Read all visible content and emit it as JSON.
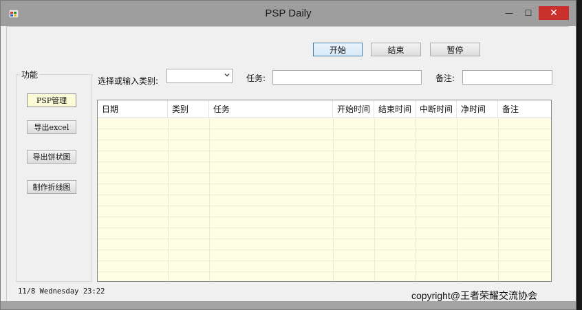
{
  "window": {
    "title": "PSP Daily"
  },
  "titlebar": {
    "minimize_glyph": "—",
    "maximize_glyph": "☐",
    "close_glyph": "✕"
  },
  "timer_buttons": {
    "start": "开始",
    "stop": "结束",
    "pause": "暂停"
  },
  "function_panel": {
    "title": "功能",
    "buttons": [
      "PSP管理",
      "导出excel",
      "导出饼状图",
      "制作折线图"
    ]
  },
  "form": {
    "category_label": "选择或输入类别:",
    "category_value": "",
    "task_label": "任务:",
    "task_value": "",
    "note_label": "备注:",
    "note_value": ""
  },
  "grid": {
    "columns": [
      "日期",
      "类别",
      "任务",
      "开始时间",
      "结束时间",
      "中断时间",
      "净时间",
      "备注"
    ],
    "rows": []
  },
  "status": {
    "datetime": "11/8  Wednesday 23:22"
  },
  "footer": {
    "copyright": "copyright@王者荣耀交流协会"
  },
  "colors": {
    "grid_background": "#fefee4",
    "close_button": "#c9302c",
    "titlebar": "#9e9e9e"
  }
}
